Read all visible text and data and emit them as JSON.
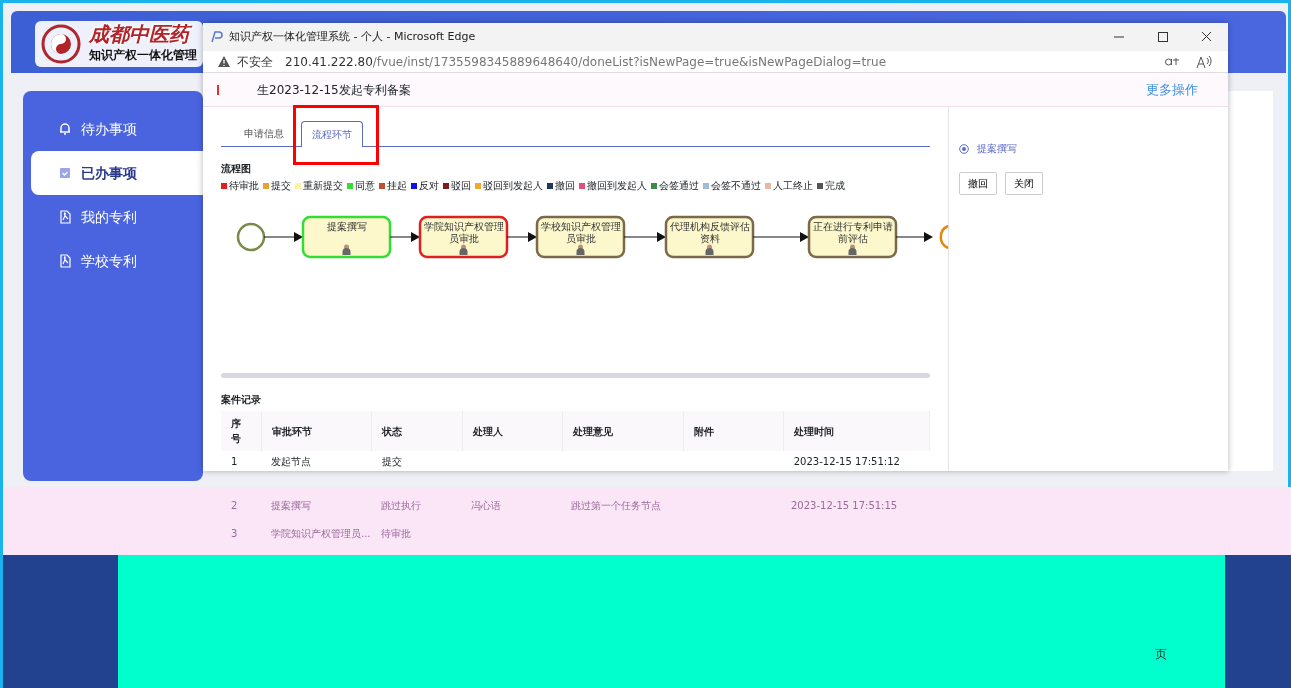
{
  "app": {
    "logo_text": "成都中医药",
    "subtitle": "知识产权一体化管理",
    "sidebar": [
      {
        "label": "待办事项",
        "selected": false
      },
      {
        "label": "已办事项",
        "selected": true
      },
      {
        "label": "我的专利",
        "selected": false
      },
      {
        "label": "学校专利",
        "selected": false
      }
    ]
  },
  "popup": {
    "title": "知识产权一体化管理系统 - 个人 - Microsoft Edge",
    "security": "不安全",
    "url_host": "210.41.222.80",
    "url_path": "/fvue/inst/1735598345889648640/doneList?isNewPage=true&isNewPageDialog=true",
    "header_title": "生2023-12-15发起专利备案",
    "more_actions": "更多操作",
    "tabs": [
      {
        "label": "申请信息",
        "selected": false
      },
      {
        "label": "流程环节",
        "selected": true,
        "highlighted": true
      }
    ],
    "flow_title": "流程图",
    "legend": [
      {
        "label": "待审批",
        "color": "#e02020"
      },
      {
        "label": "提交",
        "color": "#e6a23c"
      },
      {
        "label": "重新提交",
        "color": "#fff3a0"
      },
      {
        "label": "同意",
        "color": "#33dd33"
      },
      {
        "label": "挂起",
        "color": "#c0502c"
      },
      {
        "label": "反对",
        "color": "#1010e0"
      },
      {
        "label": "驳回",
        "color": "#7a1e1e"
      },
      {
        "label": "驳回到发起人",
        "color": "#f0a830"
      },
      {
        "label": "撤回",
        "color": "#1e3a5a"
      },
      {
        "label": "撤回到发起人",
        "color": "#e0507a"
      },
      {
        "label": "会签通过",
        "color": "#3a8a4a"
      },
      {
        "label": "会签不通过",
        "color": "#a0bcd8"
      },
      {
        "label": "人工终止",
        "color": "#e8b8a0"
      },
      {
        "label": "完成",
        "color": "#555555"
      }
    ],
    "flow_nodes": [
      {
        "lines": [
          "提案撰写"
        ],
        "color": "#33dd33"
      },
      {
        "lines": [
          "学院知识产权管理",
          "员审批"
        ],
        "color": "#e02020"
      },
      {
        "lines": [
          "学校知识产权管理",
          "员审批"
        ],
        "color": "#7a6a4a"
      },
      {
        "lines": [
          "代理机构反馈评估",
          "资料"
        ],
        "color": "#7a6a4a"
      },
      {
        "lines": [
          "正在进行专利申请",
          "前评估"
        ],
        "color": "#7a6a4a"
      }
    ],
    "records_title": "案件记录",
    "columns": [
      "序号",
      "审批环节",
      "状态",
      "处理人",
      "处理意见",
      "附件",
      "处理时间"
    ],
    "rows": [
      {
        "cells": [
          "1",
          "发起节点",
          "提交",
          "",
          "",
          "",
          "2023-12-15 17:51:12"
        ],
        "glitched": false
      },
      {
        "cells": [
          "2",
          "提案撰写",
          "跳过执行",
          "冯心语",
          "跳过第一个任务节点",
          "",
          "2023-12-15 17:51:15"
        ],
        "glitched": true
      },
      {
        "cells": [
          "3",
          "学院知识产权管理员...",
          "待审批",
          "",
          "",
          "",
          ""
        ],
        "glitched": true
      }
    ],
    "side": {
      "radio_label": "提案撰写",
      "radio_selected": true,
      "buttons": [
        "撤回",
        "关闭"
      ]
    }
  },
  "page_fragment": "页"
}
